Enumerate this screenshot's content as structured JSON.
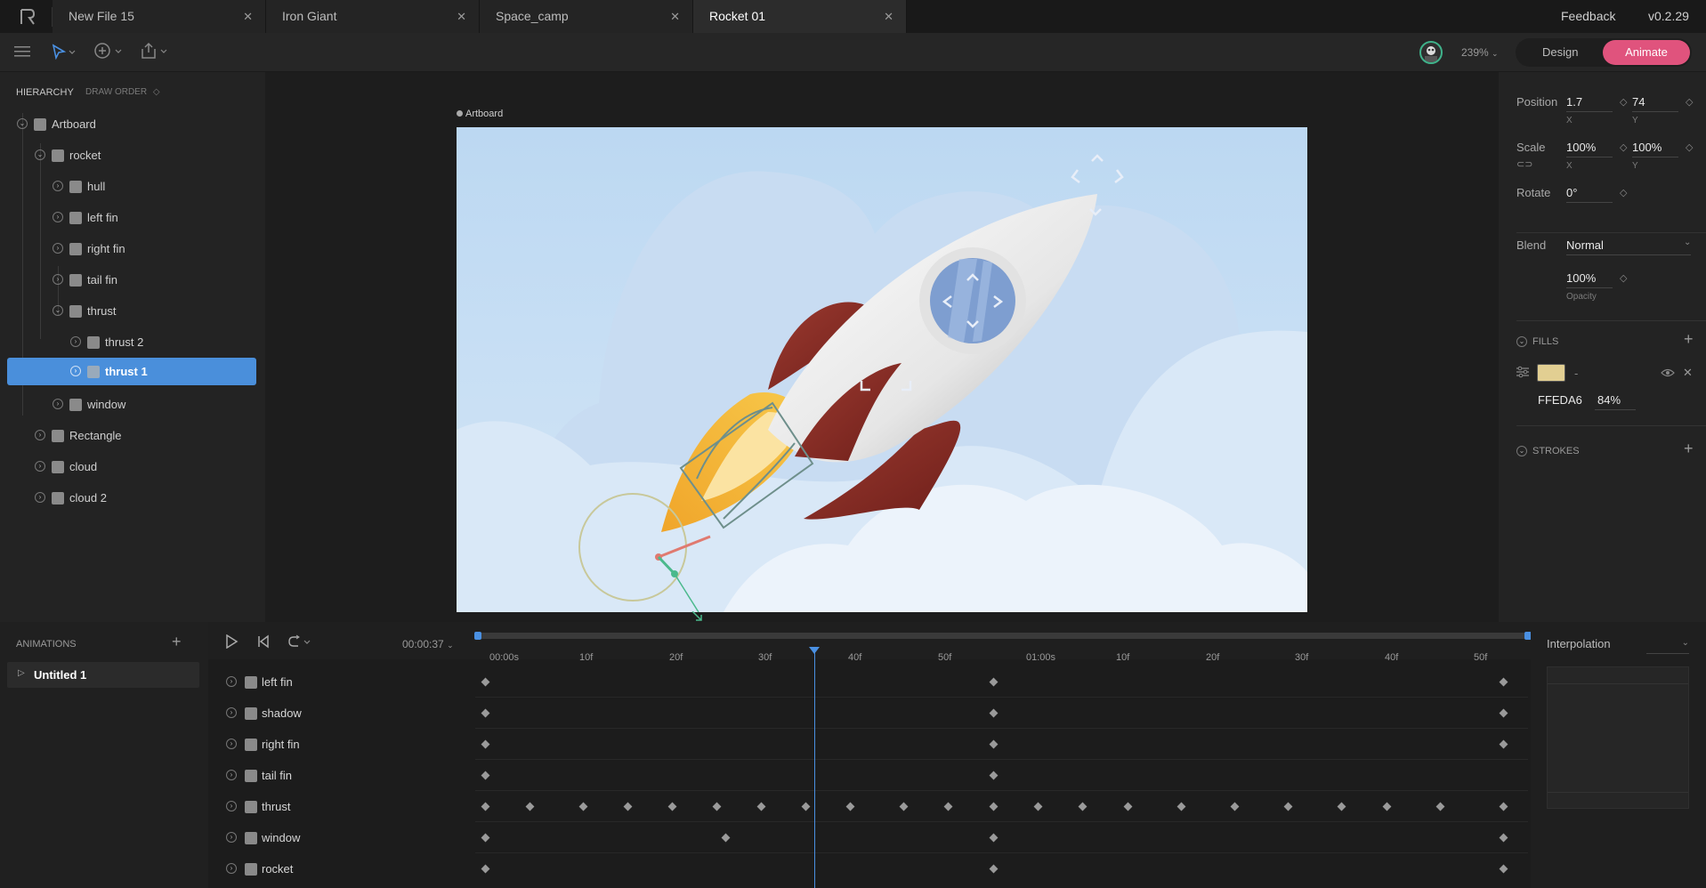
{
  "tabs": [
    {
      "label": "New File 15"
    },
    {
      "label": "Iron Giant"
    },
    {
      "label": "Space_camp"
    },
    {
      "label": "Rocket 01"
    }
  ],
  "header": {
    "feedback": "Feedback",
    "version": "v0.2.29"
  },
  "toolbar": {
    "zoom": "239%",
    "mode_design": "Design",
    "mode_animate": "Animate"
  },
  "hierarchy": {
    "title": "HIERARCHY",
    "draw_order": "DRAW ORDER",
    "items": [
      {
        "label": "Artboard"
      },
      {
        "label": "rocket"
      },
      {
        "label": "hull"
      },
      {
        "label": "left fin"
      },
      {
        "label": "right fin"
      },
      {
        "label": "tail fin"
      },
      {
        "label": "thrust"
      },
      {
        "label": "thrust 2"
      },
      {
        "label": "thrust 1"
      },
      {
        "label": "window"
      },
      {
        "label": "Rectangle"
      },
      {
        "label": "cloud"
      },
      {
        "label": "cloud 2"
      }
    ]
  },
  "artboard": {
    "label": "Artboard"
  },
  "properties": {
    "position_label": "Position",
    "position_x": "1.7",
    "position_y": "74",
    "scale_label": "Scale",
    "scale_x": "100%",
    "scale_y": "100%",
    "rotate_label": "Rotate",
    "rotate": "0°",
    "x": "X",
    "y": "Y",
    "blend_label": "Blend",
    "blend": "Normal",
    "opacity": "100%",
    "opacity_label": "Opacity",
    "fills_label": "FILLS",
    "fill_hex": "FFEDA6",
    "fill_opacity": "84%",
    "fill_dash": "-",
    "fill_color": "#e2cf92",
    "strokes_label": "STROKES"
  },
  "animations": {
    "title": "ANIMATIONS",
    "items": [
      {
        "label": "Untitled 1"
      }
    ]
  },
  "timeline": {
    "time": "00:00:37",
    "ticks": [
      "00:00s",
      "10f",
      "20f",
      "30f",
      "40f",
      "50f",
      "01:00s",
      "10f",
      "20f",
      "30f",
      "40f",
      "50f"
    ],
    "tracks": [
      {
        "label": "left fin"
      },
      {
        "label": "shadow"
      },
      {
        "label": "right fin"
      },
      {
        "label": "tail fin"
      },
      {
        "label": "thrust"
      },
      {
        "label": "window"
      },
      {
        "label": "rocket"
      }
    ]
  },
  "interpolation": {
    "label": "Interpolation"
  },
  "colors": {
    "accent": "#4a90e2",
    "animate": "#e0537d",
    "selected_row": "#4a8fdb"
  }
}
